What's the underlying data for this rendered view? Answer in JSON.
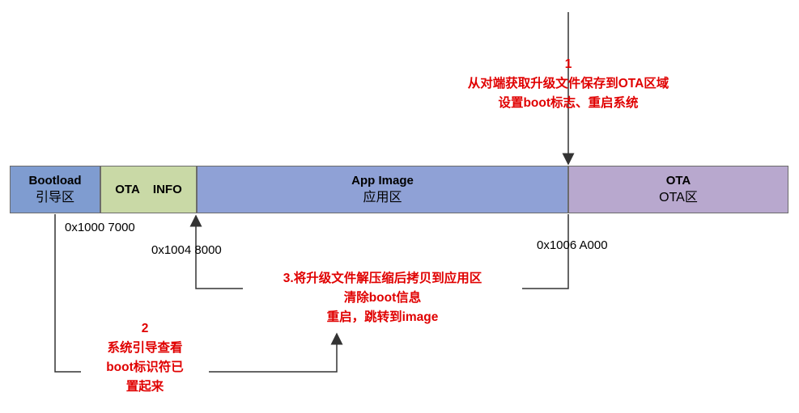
{
  "blocks": {
    "bootloader": {
      "name": "Bootload",
      "sub": "引导区",
      "color": "#7f9cd0"
    },
    "ota_info": {
      "name": "OTA    INFO",
      "color": "#c9d9a6"
    },
    "app": {
      "name": "App Image",
      "sub": "应用区",
      "color": "#8fa1d6"
    },
    "ota": {
      "name": "OTA",
      "sub": "OTA区",
      "color": "#b8a8ce"
    }
  },
  "addresses": {
    "bootloader": "0x1000 7000",
    "ota_info": "0x1004 8000",
    "ota": "0x1006 A000"
  },
  "notes": {
    "step1": {
      "num": "1",
      "line1": "从对端获取升级文件保存到OTA区域",
      "line2": "设置boot标志、重启系统"
    },
    "step2": {
      "num": "2",
      "line1": "系统引导查看",
      "line2": "boot标识符已",
      "line3": "置起来"
    },
    "step3": {
      "line1": "3.将升级文件解压缩后拷贝到应用区",
      "line2": "清除boot信息",
      "line3": "重启，跳转到image"
    }
  },
  "colors": {
    "note_text": "#e00000",
    "line": "#333333"
  }
}
